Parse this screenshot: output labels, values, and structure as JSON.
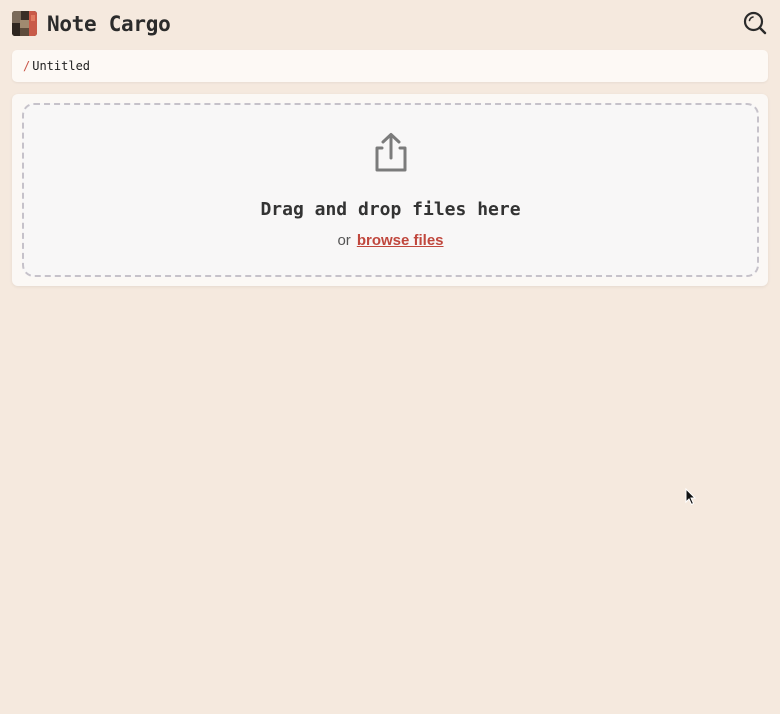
{
  "app": {
    "title": "Note Cargo"
  },
  "breadcrumb": {
    "separator": "/",
    "current": "Untitled"
  },
  "dropzone": {
    "title": "Drag and drop files here",
    "or_text": "or",
    "browse_label": "browse files"
  },
  "icons": {
    "logo": "app-logo",
    "search": "search-icon",
    "upload": "upload-icon",
    "cursor": "mouse-cursor"
  },
  "colors": {
    "background": "#f5e9de",
    "accent": "#c0473d",
    "text": "#2b2b2b"
  }
}
